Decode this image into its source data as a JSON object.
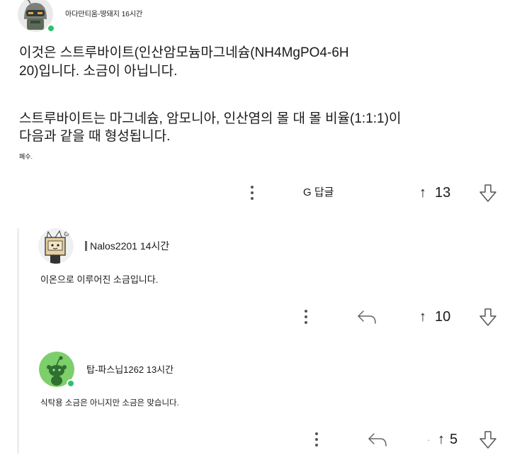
{
  "comment": {
    "author": "아다만티움-땅돼지",
    "time": "16시간",
    "online": true,
    "lines": [
      "이것은 스트루바이트(인산암모늄마그네슘(NH4MgPO4-6H",
      "20)입니다. 소금이 아닙니다.",
      "스트루바이트는 마그네슘, 암모니아, 인산염의 몰 대 몰 비율(1:1:1)이",
      "다음과 같을 때 형성됩니다."
    ],
    "footnote": "폐수.",
    "reply_label": "G 답글",
    "score": "13"
  },
  "replies": [
    {
      "author": "Nalos2201",
      "time": "14시간",
      "text": "이온으로 이루어진 소금입니다.",
      "score": "10"
    },
    {
      "author": "탑-파스닙1262",
      "time": "13시간",
      "online": true,
      "text": "식탁용 소금은 아니지만 소금은 맞습니다.",
      "score_prefix": "·",
      "score": "5"
    }
  ],
  "upvote_glyph": "↑",
  "icons": {
    "more": "vertical-ellipsis-icon",
    "reply": "reply-arrow-icon",
    "upvote": "upvote-arrow-icon",
    "downvote": "downvote-arrow-icon",
    "flair": "flair-icon"
  },
  "colors": {
    "text": "#1a1a1b",
    "secondary": "#555555",
    "online": "#2fbf71",
    "thread_line": "#d4d4d4",
    "avatar_green": "#7ccf6a"
  }
}
